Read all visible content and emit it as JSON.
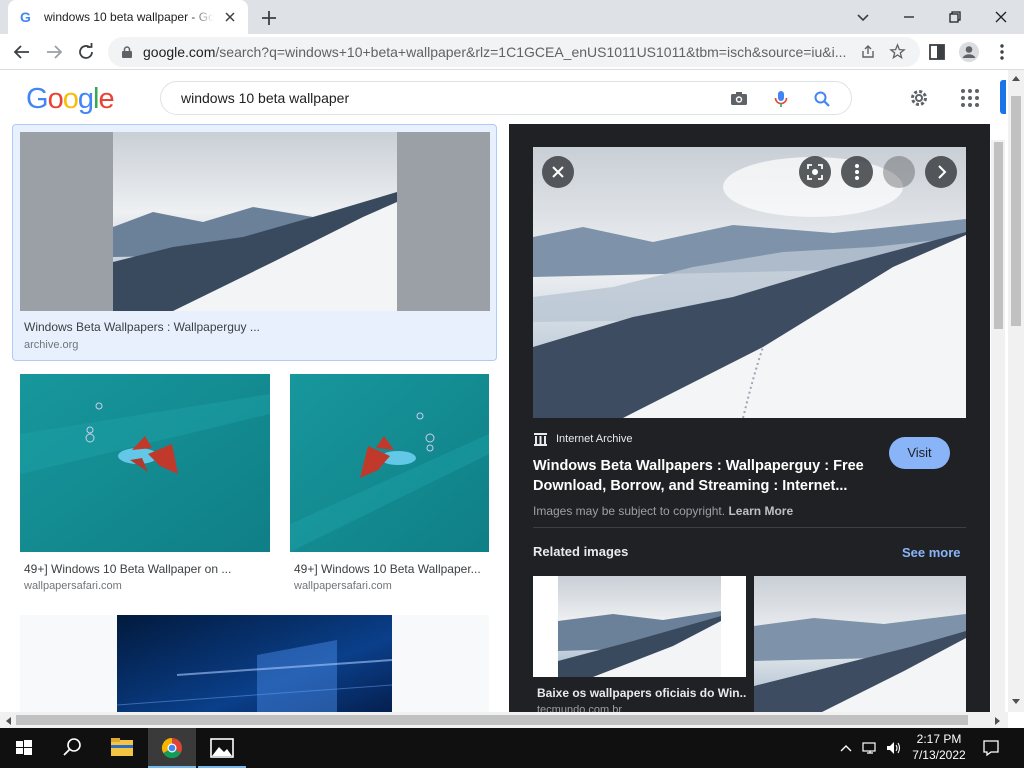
{
  "browser": {
    "tab_title": "windows 10 beta wallpaper - Goo",
    "url_host": "google.com",
    "url_rest": "/search?q=windows+10+beta+wallpaper&rlz=1C1GCEA_enUS1011US1011&tbm=isch&source=iu&i..."
  },
  "search": {
    "logo": [
      "G",
      "o",
      "o",
      "g",
      "l",
      "e"
    ],
    "query": "windows 10 beta wallpaper"
  },
  "results": [
    {
      "title": "Windows Beta Wallpapers : Wallpaperguy ...",
      "source": "archive.org"
    },
    {
      "title": "49+] Windows 10 Beta Wallpaper on ...",
      "source": "wallpapersafari.com"
    },
    {
      "title": "49+] Windows 10 Beta Wallpaper...",
      "source": "wallpapersafari.com"
    }
  ],
  "preview": {
    "source_name": "Internet Archive",
    "title": "Windows Beta Wallpapers : Wallpaperguy : Free Download, Borrow, and Streaming : Internet...",
    "copyright": "Images may be subject to copyright.",
    "learn_more": "Learn More",
    "visit_label": "Visit",
    "related_heading": "Related images",
    "see_more": "See more",
    "related": [
      {
        "title": "Baixe os wallpapers oficiais do Win...",
        "source": "tecmundo.com.br"
      }
    ]
  },
  "taskbar": {
    "time": "2:17 PM",
    "date": "7/13/2022"
  },
  "colors": {
    "accent_blue": "#1a73e8",
    "panel_bg": "#202124",
    "visit_bg": "#8ab4f8",
    "selected_card_bg": "#e8f0fe"
  }
}
